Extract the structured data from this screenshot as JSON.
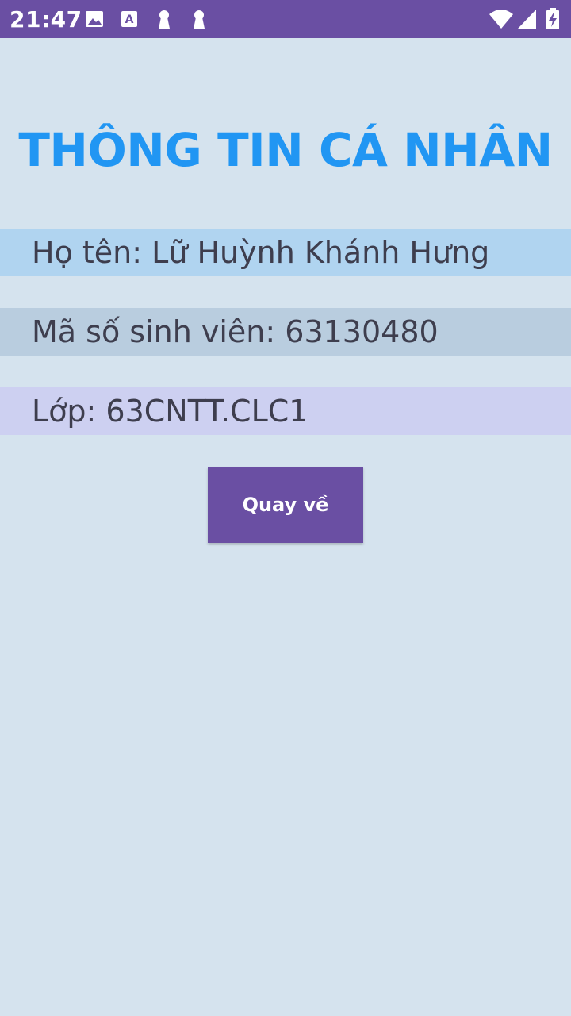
{
  "status_bar": {
    "time": "21:47",
    "left_icons": [
      "image-icon",
      "accessibility-icon",
      "keyhole-icon",
      "keyhole-icon"
    ],
    "right_icons": [
      "wifi-icon",
      "signal-icon",
      "battery-charging-icon"
    ]
  },
  "page": {
    "title": "THÔNG TIN CÁ NHÂN",
    "name_line": "Họ tên: Lữ Huỳnh Khánh Hưng",
    "student_id_line": "Mã số sinh viên: 63130480",
    "class_line": "Lớp: 63CNTT.CLC1",
    "back_button_label": "Quay về"
  },
  "colors": {
    "status_bar": "#6a4fa3",
    "background": "#d5e3ee",
    "title": "#2196f3",
    "row_name": "#b0d4f0",
    "row_student_id": "#b9cddf",
    "row_class": "#cdd0f1",
    "button": "#6a4fa3"
  }
}
